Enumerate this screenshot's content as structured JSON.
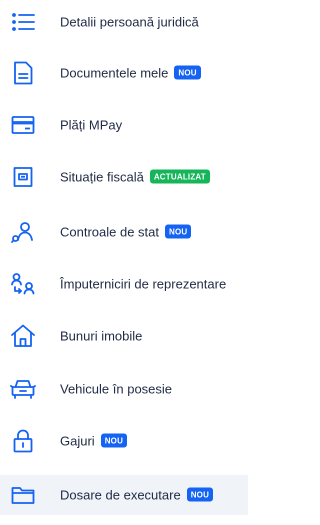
{
  "colors": {
    "icon": "#1463f3",
    "text": "#1f2a44",
    "badge_new": "#1463f3",
    "badge_updated": "#16b55a",
    "active_bg": "#f0f3f8"
  },
  "menu": {
    "items": [
      {
        "label": "Detalii persoană juridică",
        "icon": "list-icon"
      },
      {
        "label": "Documentele mele",
        "icon": "document-icon",
        "badge": "NOU"
      },
      {
        "label": "Plăți MPay",
        "icon": "card-icon"
      },
      {
        "label": "Situație fiscală",
        "icon": "tax-icon",
        "badge": "ACTUALIZAT"
      },
      {
        "label": "Controale de stat",
        "icon": "inspection-icon",
        "badge": "NOU"
      },
      {
        "label": "Împuterniciri de reprezentare",
        "icon": "delegation-icon"
      },
      {
        "label": "Bunuri imobile",
        "icon": "house-icon"
      },
      {
        "label": "Vehicule în posesie",
        "icon": "car-icon"
      },
      {
        "label": "Gajuri",
        "icon": "lock-icon",
        "badge": "NOU"
      },
      {
        "label": "Dosare de executare",
        "icon": "folder-icon",
        "badge": "NOU",
        "active": true
      }
    ]
  }
}
